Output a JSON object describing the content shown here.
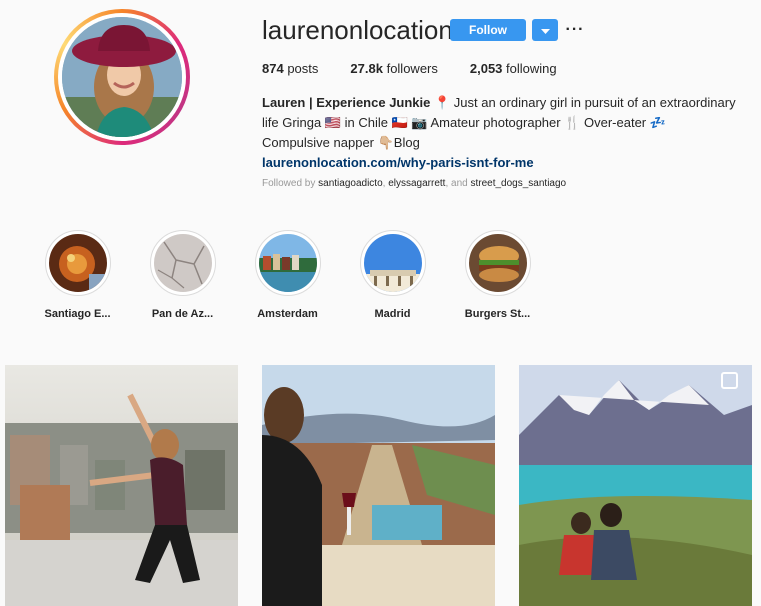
{
  "profile": {
    "username": "laurenonlocation",
    "follow_label": "Follow",
    "more_label": "···"
  },
  "stats": {
    "posts_count": "874",
    "posts_label": "posts",
    "followers_count": "27.8k",
    "followers_label": "followers",
    "following_count": "2,053",
    "following_label": "following"
  },
  "bio": {
    "name": "Lauren | Experience Junkie",
    "line1_rest": " 📍 Just an ordinary girl in pursuit of an extraordinary",
    "line2": "life Gringa 🇺🇸 in Chile 🇨🇱 📷 Amateur photographer 🍴 Over-eater 💤",
    "line3": "Compulsive napper 👇🏼Blog",
    "link": "laurenonlocation.com/why-paris-isnt-for-me"
  },
  "followed_by": {
    "prefix": "Followed by ",
    "accounts": [
      "santiagoadicto",
      "elyssagarrett",
      "street_dogs_santiago"
    ],
    "sep1": ", ",
    "sep2": ", and "
  },
  "highlights": [
    {
      "label": "Santiago E..."
    },
    {
      "label": "Pan de Az..."
    },
    {
      "label": "Amsterdam"
    },
    {
      "label": "Madrid"
    },
    {
      "label": "Burgers St..."
    }
  ],
  "colors": {
    "accent": "#3897f0",
    "link": "#003569",
    "muted": "#999999"
  },
  "icons": {
    "dropdown": "chevron-down-icon",
    "more": "more-horizontal-icon",
    "multi": "multiple-posts-icon"
  }
}
